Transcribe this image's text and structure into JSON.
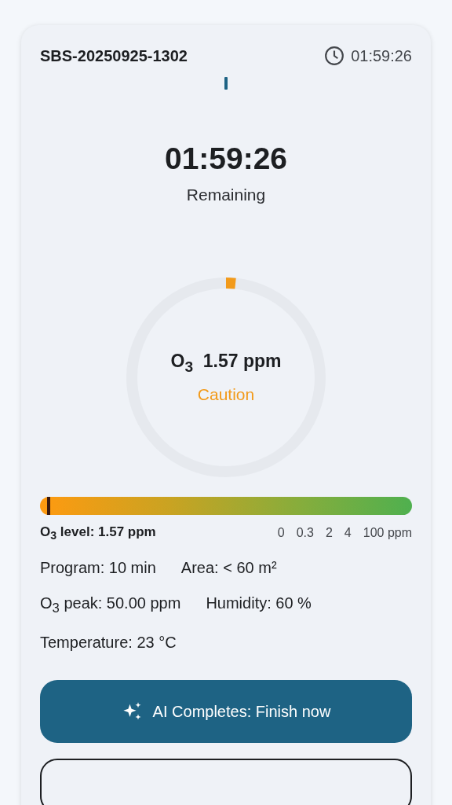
{
  "header": {
    "session_id": "SBS-20250925-1302",
    "elapsed": "01:59:26"
  },
  "timer": {
    "time": "01:59:26",
    "label": "Remaining"
  },
  "gauge": {
    "level": 0.016,
    "reading": "O$_{3}$  1.57 ppm",
    "status": "Caution",
    "kind": "caution"
  },
  "scale": {
    "level": 0.02,
    "reading": "O$_{3}$ level: 1.57 ppm",
    "ticks": [
      "0",
      "0.3",
      "2",
      "4",
      "100 ppm"
    ]
  },
  "info_rows": [
    [
      "Program: 10 min",
      "Area: < 60 m²"
    ],
    [
      "O$_{3}$ peak: 50.00 ppm",
      "Humidity: 60 %"
    ],
    [
      "Temperature: 23 °C"
    ]
  ],
  "primary_button": {
    "label": "AI Completes: Finish now"
  }
}
